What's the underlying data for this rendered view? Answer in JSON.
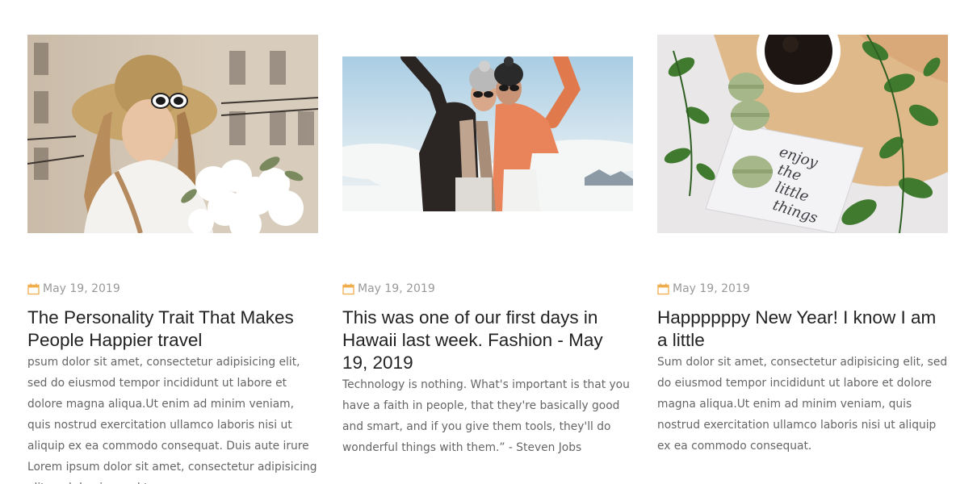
{
  "posts": [
    {
      "date": "May 19, 2019",
      "date_icon": "calendar-icon",
      "title": "The Personality Trait That Makes People Happier travel",
      "excerpt": "psum dolor sit amet, consectetur adipisicing elit, sed do eiusmod tempor incididunt ut labore et dolore magna aliqua.Ut enim ad minim veniam, quis nostrud exercitation ullamco laboris nisi ut aliquip ex ea commodo consequat. Duis aute irure Lorem ipsum dolor sit amet, consectetur adipisicing elit, sed do eiusmod tempor"
    },
    {
      "date": "May 19, 2019",
      "date_icon": "calendar-icon",
      "title": "This was one of our first days in Hawaii last week. Fashion - May 19, 2019",
      "excerpt": "Technology is nothing. What's important is that you have a faith in people, that they're basically good and smart, and if you give them tools, they'll do wonderful things with them.” - Steven Jobs"
    },
    {
      "date": "May 19, 2019",
      "date_icon": "calendar-icon",
      "title": "Happppppy New Year! I know I am a little",
      "excerpt": "Sum dolor sit amet, consectetur adipisicing elit, sed do eiusmod tempor incididunt ut labore et dolore magna aliqua.Ut enim ad minim veniam, quis nostrud exercitation ullamco laboris nisi ut aliquip ex ea commodo consequat."
    }
  ],
  "colors": {
    "accent": "#f0ad4e",
    "title": "#222222",
    "meta": "#999999",
    "body": "#666666"
  }
}
